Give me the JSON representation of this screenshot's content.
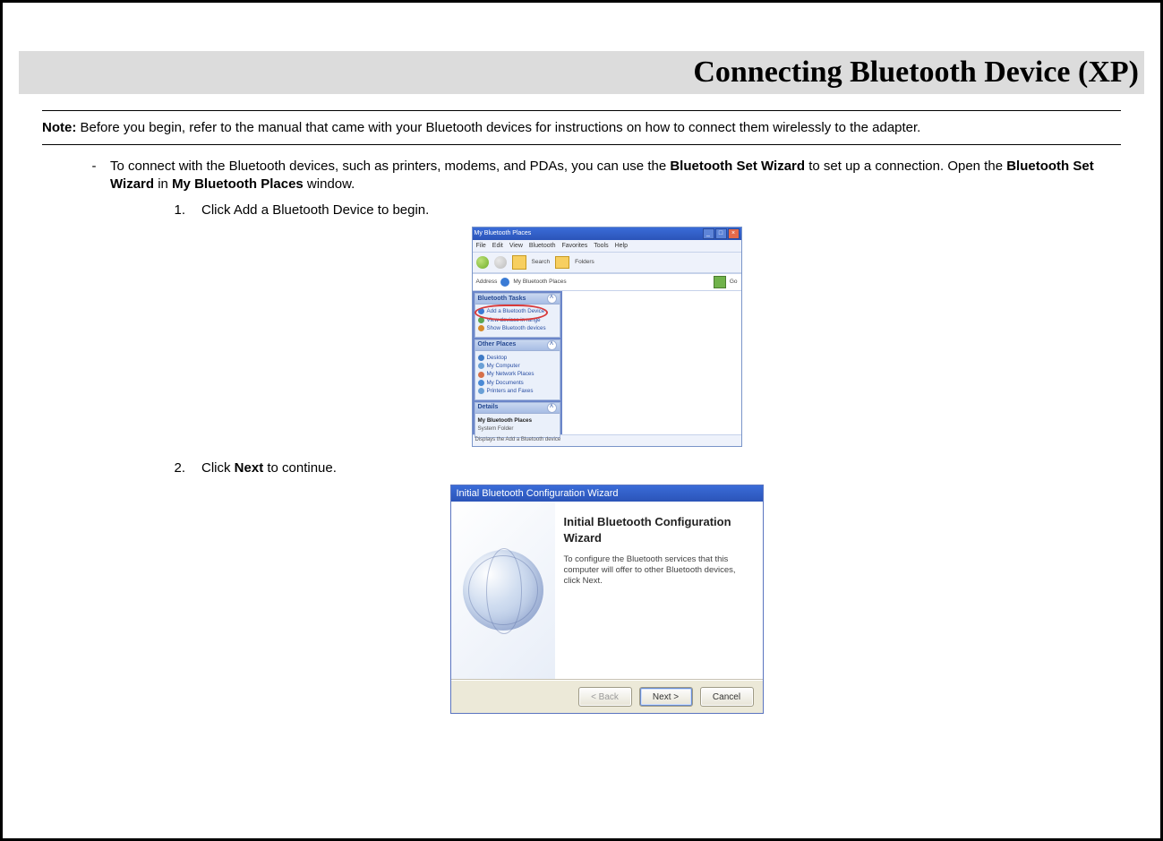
{
  "page": {
    "title": "Connecting Bluetooth Device (XP)",
    "note_label": "Note:",
    "note_text": " Before you begin, refer to the manual that came with your Bluetooth devices for instructions on how to connect them wirelessly to the adapter.",
    "intro_pre": "To connect with the Bluetooth devices, such as printers, modems, and PDAs, you can use the ",
    "intro_b1": "Bluetooth Set Wizard",
    "intro_mid": " to set up a connection. Open the ",
    "intro_b2": "Bluetooth Set Wizard",
    "intro_mid2": " in ",
    "intro_b3": "My Bluetooth Places",
    "intro_post": " window."
  },
  "steps": {
    "s1_num": "1.",
    "s1_text": "Click Add a Bluetooth Device to begin.",
    "s2_num": "2.",
    "s2_pre": "Click ",
    "s2_b": "Next",
    "s2_post": " to continue."
  },
  "fig1": {
    "title": "My Bluetooth Places",
    "menu": [
      "File",
      "Edit",
      "View",
      "Bluetooth",
      "Favorites",
      "Tools",
      "Help"
    ],
    "tool_search": "Search",
    "tool_folders": "Folders",
    "addr_label": "Address",
    "addr_value": "My Bluetooth Places",
    "go": "Go",
    "panel1_hd": "Bluetooth Tasks",
    "task_add": "Add a Bluetooth Device",
    "task_view": "View devices in range",
    "task_show": "Show Bluetooth devices",
    "panel2_hd": "Other Places",
    "op1": "Desktop",
    "op2": "My Computer",
    "op3": "My Network Places",
    "op4": "My Documents",
    "op5": "Printers and Faxes",
    "panel3_hd": "Details",
    "det1": "My Bluetooth Places",
    "det2": "System Folder",
    "status": "Displays the Add a Bluetooth device"
  },
  "fig2": {
    "title": "Initial Bluetooth Configuration Wizard",
    "heading": "Initial Bluetooth Configuration Wizard",
    "body": "To configure the Bluetooth services that this computer will offer to other Bluetooth devices, click Next.",
    "back": "< Back",
    "next": "Next >",
    "cancel": "Cancel"
  }
}
